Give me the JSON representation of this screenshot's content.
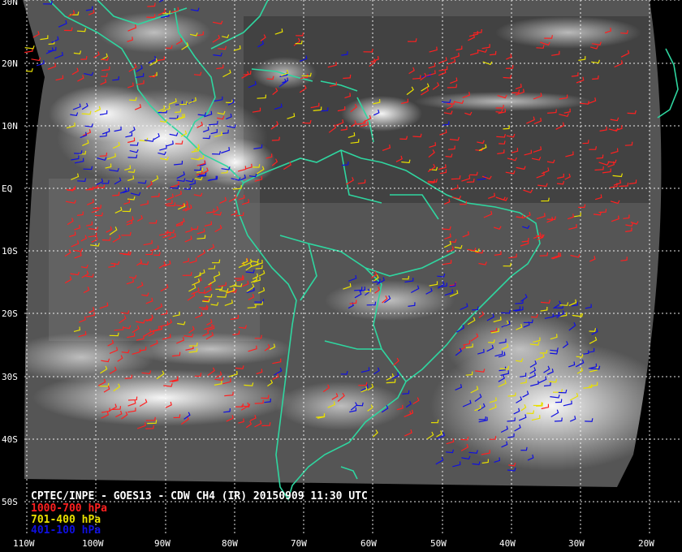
{
  "caption": "CPTEC/INPE - GOES13 - CDW CH4 (IR) 20150909 11:30 UTC",
  "legend": [
    {
      "label": "1000-700 hPa",
      "color": "#ff2020"
    },
    {
      "label": "701-400 hPa",
      "color": "#e8e000"
    },
    {
      "label": "401-100 hPa",
      "color": "#1010e0"
    }
  ],
  "lat_labels": [
    "30N",
    "20N",
    "10N",
    "EQ",
    "10S",
    "20S",
    "30S",
    "40S",
    "50S"
  ],
  "lon_labels": [
    "110W",
    "100W",
    "90W",
    "80W",
    "70W",
    "60W",
    "50W",
    "40W",
    "30W",
    "20W"
  ],
  "colors": {
    "coastline": "#2fd6a0",
    "gridline": "#ffffff",
    "background": "#000000"
  }
}
